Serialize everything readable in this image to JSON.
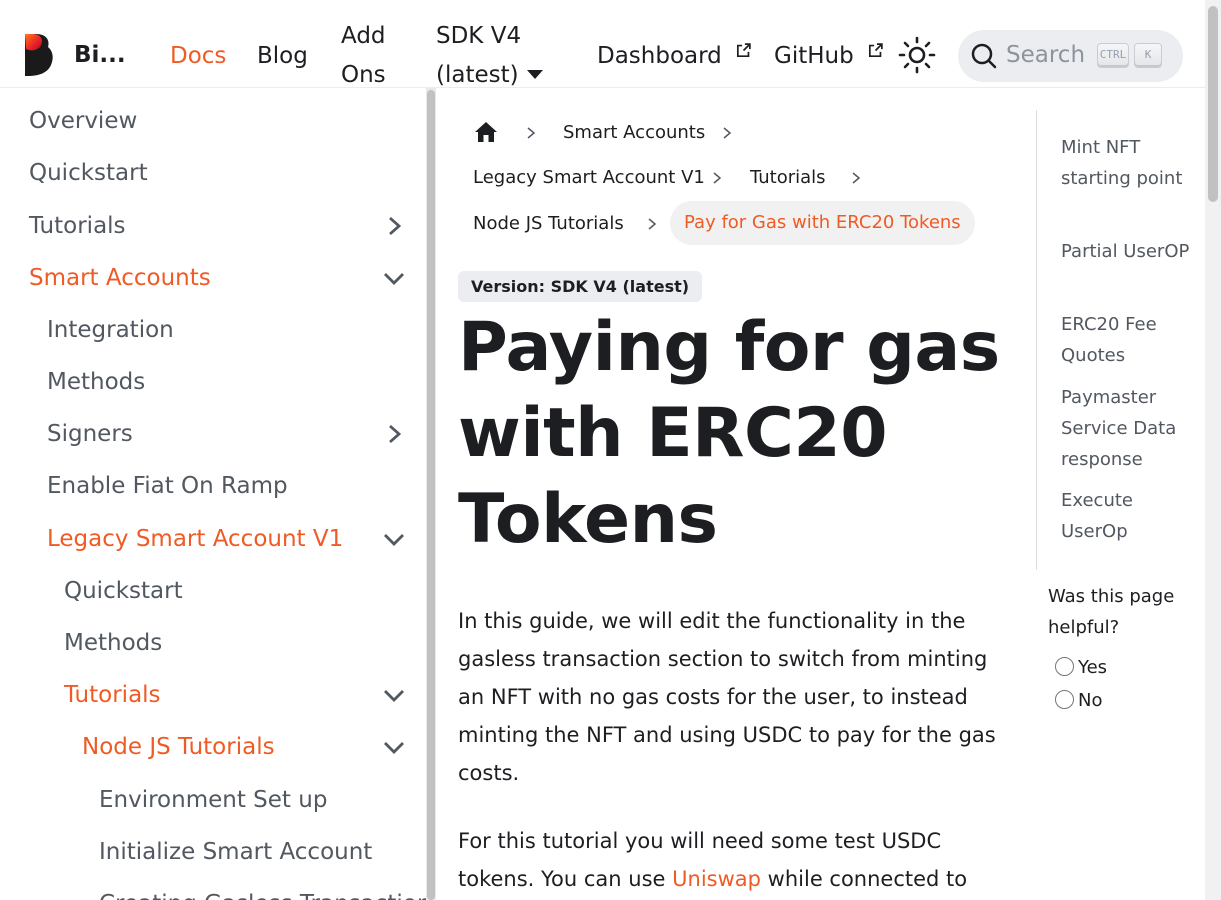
{
  "navbar": {
    "brand": "Bi...",
    "links": {
      "docs": "Docs",
      "blog": "Blog",
      "addons_line1": "Add",
      "addons_line2": "Ons",
      "version_line1": "SDK V4",
      "version_line2": "(latest)",
      "dashboard": "Dashboard",
      "github": "GitHub"
    },
    "search": {
      "placeholder": "Search",
      "key1": "CTRL",
      "key2": "K"
    }
  },
  "sidebar": {
    "items": [
      {
        "label": "Overview"
      },
      {
        "label": "Quickstart"
      },
      {
        "label": "Tutorials"
      },
      {
        "label": "Smart Accounts"
      },
      {
        "label": "Integration"
      },
      {
        "label": "Methods"
      },
      {
        "label": "Signers"
      },
      {
        "label": "Enable Fiat On Ramp"
      },
      {
        "label": "Legacy Smart Account V1"
      },
      {
        "label": "Quickstart"
      },
      {
        "label": "Methods"
      },
      {
        "label": "Tutorials"
      },
      {
        "label": "Node JS Tutorials"
      },
      {
        "label": "Environment Set up"
      },
      {
        "label": "Initialize Smart Account"
      },
      {
        "label": "Creating Gasless Transactions"
      }
    ]
  },
  "breadcrumb": {
    "items": [
      "Smart Accounts",
      "Legacy Smart Account V1",
      "Tutorials",
      "Node JS Tutorials",
      "Pay for Gas with ERC20 Tokens"
    ]
  },
  "main": {
    "version_badge": "Version: SDK V4 (latest)",
    "title": "Paying for gas with ERC20 Tokens",
    "intro": "In this guide, we will edit the functionality in the gasless transaction section to switch from minting an NFT with no gas costs for the user, to instead minting the NFT and using USDC to pay for the gas costs.",
    "para2_before": "For this tutorial you will need some test USDC tokens. You can use ",
    "para2_link": "Uniswap",
    "para2_after": " while connected to"
  },
  "toc": {
    "items": [
      "Mint NFT starting point",
      "Partial UserOP",
      "ERC20 Fee Quotes",
      "Paymaster Service Data response",
      "Execute UserOp"
    ]
  },
  "feedback": {
    "question": "Was this page helpful?",
    "yes": "Yes",
    "no": "No"
  },
  "colors": {
    "accent": "#f05a24",
    "text": "#1c1e21",
    "muted": "#525860"
  }
}
